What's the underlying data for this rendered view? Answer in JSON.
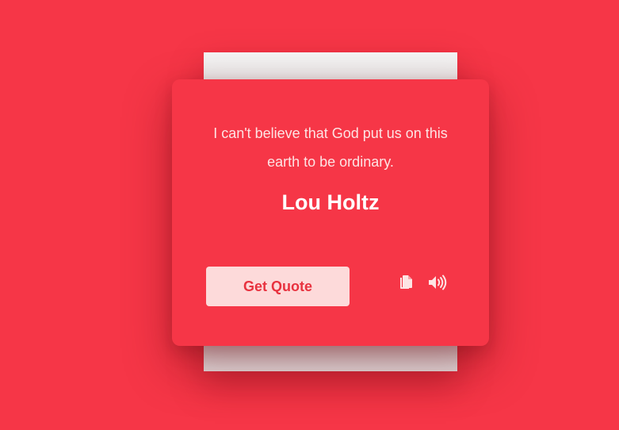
{
  "quote": {
    "text": "I can't believe that God put us on this earth to be ordinary.",
    "author": "Lou Holtz"
  },
  "actions": {
    "get_quote_label": "Get Quote",
    "copy_icon": "copy-icon",
    "sound_icon": "speaker-icon"
  },
  "colors": {
    "background": "#f63647",
    "button_bg": "#fddada",
    "button_text": "#e8323f",
    "icon": "#fde4e4"
  }
}
